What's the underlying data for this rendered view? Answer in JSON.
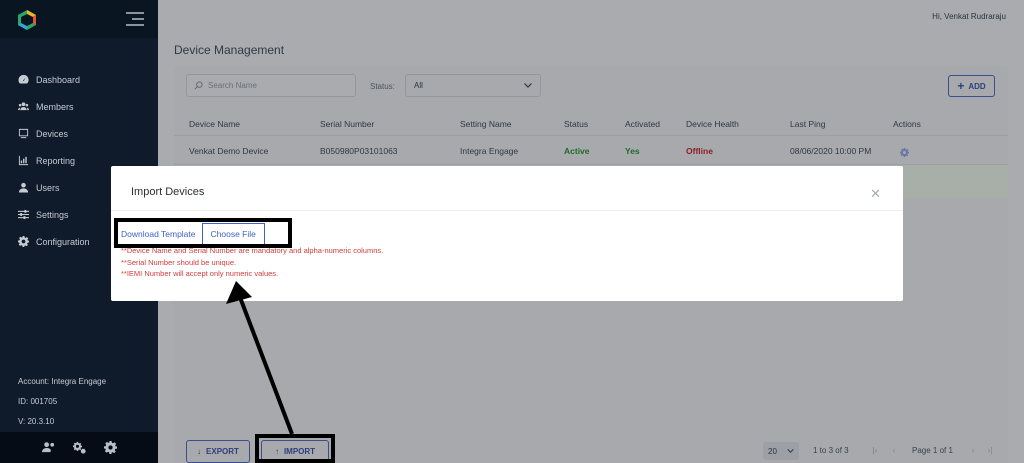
{
  "header": {
    "greeting": "Hi, Venkat Rudraraju"
  },
  "sidebar": {
    "items": [
      {
        "label": "Dashboard",
        "icon": "dashboard-icon"
      },
      {
        "label": "Members",
        "icon": "members-icon"
      },
      {
        "label": "Devices",
        "icon": "devices-icon"
      },
      {
        "label": "Reporting",
        "icon": "reporting-icon"
      },
      {
        "label": "Users",
        "icon": "user-icon"
      },
      {
        "label": "Settings",
        "icon": "sliders-icon"
      },
      {
        "label": "Configuration",
        "icon": "gear-icon"
      }
    ],
    "account": "Account: Integra Engage",
    "id": "ID: 001705",
    "version": "V: 20.3.10"
  },
  "page": {
    "title": "Device Management"
  },
  "filters": {
    "search_placeholder": "Search Name",
    "status_label": "Status:",
    "status_value": "All",
    "add_label": "ADD"
  },
  "table": {
    "columns": [
      "Device Name",
      "Serial Number",
      "Setting Name",
      "Status",
      "Activated",
      "Device Health",
      "Last Ping",
      "Actions"
    ],
    "rows": [
      {
        "device_name": "Venkat Demo Device",
        "serial_number": "B050980P03101063",
        "setting_name": "Integra Engage",
        "status": "Active",
        "activated": "Yes",
        "health": "Offline",
        "last_ping": "08/06/2020 10:00 PM"
      }
    ]
  },
  "footer": {
    "export_label": "EXPORT",
    "import_label": "IMPORT",
    "page_size": "20",
    "range": "1 to 3 of 3",
    "page": "Page 1 of 1"
  },
  "modal": {
    "title": "Import Devices",
    "download_template": "Download Template",
    "choose_file": "Choose File",
    "notes": [
      "**Device Name and Serial Number are mandatory and alpha-numeric columns.",
      "**Serial Number should be unique.",
      "**IEMI Number will accept only numeric values."
    ]
  },
  "colors": {
    "sidebar_bg": "#0f1b2a",
    "accent": "#3f62c7",
    "active_green": "#1f6b2c",
    "offline_red": "#8c1f24",
    "note_red": "#d23b3b"
  }
}
